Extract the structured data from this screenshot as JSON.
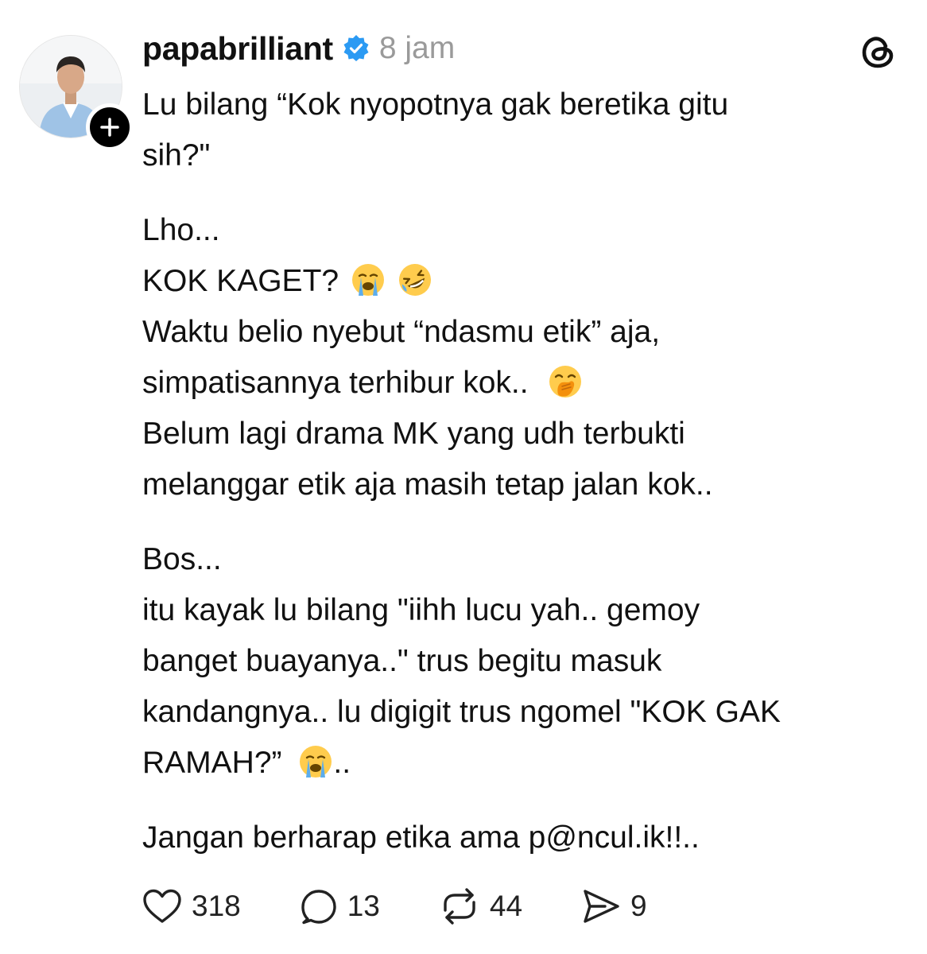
{
  "post": {
    "username": "papabrilliant",
    "timestamp": "8 jam",
    "paragraphs": [
      {
        "lines": [
          "Lu bilang “Kok nyopotnya gak beretika gitu",
          "sih?\""
        ]
      },
      {
        "lines": [
          "Lho...",
          "KOK KAGET?",
          "Waktu belio nyebut “ndasmu etik” aja,",
          "simpatisannya terhibur kok..",
          "Belum lagi drama MK yang udh terbukti",
          "melanggar etik aja masih tetap jalan kok.."
        ]
      },
      {
        "lines": [
          "Bos...",
          "itu kayak lu bilang \"iihh lucu yah.. gemoy",
          "banget buayanya..\" trus begitu masuk",
          "kandangnya.. lu digigit trus ngomel \"KOK GAK",
          "RAMAH?”",
          ".."
        ]
      },
      {
        "lines": [
          "Jangan berharap etika ama p@ncul.ik!!.."
        ]
      }
    ]
  },
  "actions": {
    "likes": "318",
    "replies": "13",
    "reposts": "44",
    "shares": "9"
  },
  "icons": {
    "avatar": "profile-photo",
    "follow": "plus-icon",
    "verified": "verified-badge-icon",
    "app_logo": "threads-logo-icon",
    "emojis": [
      "loudly-crying-face",
      "rolling-on-floor-laughing",
      "face-with-hand-over-mouth"
    ]
  },
  "colors": {
    "verified": "#2b9af3",
    "timestamp": "#9a9a9a",
    "text": "#111111",
    "background": "#ffffff"
  }
}
